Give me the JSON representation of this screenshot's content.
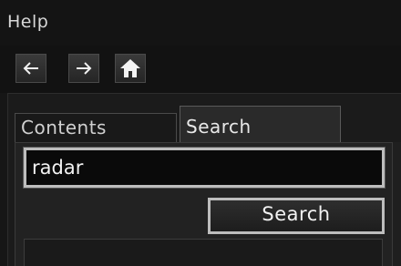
{
  "window": {
    "title": "Help"
  },
  "toolbar": {
    "back_icon": "left-arrow-icon",
    "forward_icon": "right-arrow-icon",
    "home_icon": "home-icon"
  },
  "tabs": [
    {
      "label": "Contents",
      "selected": false
    },
    {
      "label": "Search",
      "selected": true
    }
  ],
  "search": {
    "query": "radar",
    "button_label": "Search"
  },
  "colors": {
    "background": "#161616",
    "highlight_border": "#bdbdbd",
    "text": "#e6e6e6"
  }
}
